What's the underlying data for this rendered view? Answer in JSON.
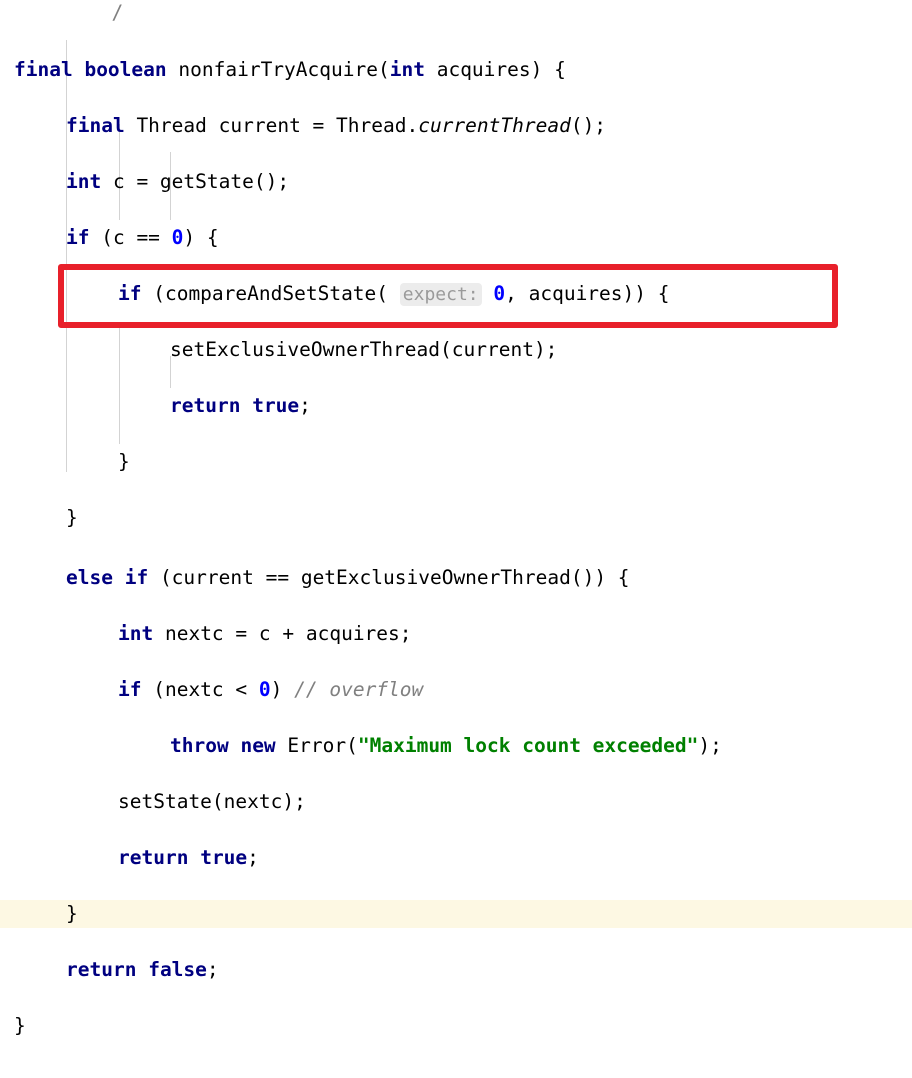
{
  "editor": {
    "language": "Java",
    "theme": "IntelliJ Light",
    "font_size_px": 19.5,
    "line_height_px": 28,
    "background_color": "#ffffff",
    "caret_line_color": "#fdf8e3",
    "indent_guide_color": "#d3d3d3",
    "colors": {
      "keyword": "#000080",
      "number": "#0000ff",
      "string": "#008000",
      "comment": "#808080",
      "identifier": "#000000",
      "parameter_hint_text": "#9a9a9a",
      "parameter_hint_background": "#ececec",
      "annotation_box": "#e8202a"
    }
  },
  "partial_comment_above": "/",
  "code_lines": [
    {
      "index": 0,
      "indent": 0,
      "highlighted": false,
      "text": "final boolean nonfairTryAcquire(int acquires) {"
    },
    {
      "index": 1,
      "indent": 1,
      "highlighted": false,
      "text": "final Thread current = Thread.currentThread();"
    },
    {
      "index": 2,
      "indent": 1,
      "highlighted": false,
      "text": "int c = getState();"
    },
    {
      "index": 3,
      "indent": 1,
      "highlighted": false,
      "text": "if (c == 0) {"
    },
    {
      "index": 4,
      "indent": 2,
      "highlighted": false,
      "text": "if (compareAndSetState( expect: 0, acquires)) {"
    },
    {
      "index": 5,
      "indent": 3,
      "highlighted": false,
      "text": "setExclusiveOwnerThread(current);"
    },
    {
      "index": 6,
      "indent": 3,
      "highlighted": false,
      "text": "return true;"
    },
    {
      "index": 7,
      "indent": 2,
      "highlighted": false,
      "text": "}"
    },
    {
      "index": 8,
      "indent": 1,
      "highlighted": false,
      "text": "}"
    },
    {
      "index": 9,
      "indent": 1,
      "highlighted": false,
      "text": "else if (current == getExclusiveOwnerThread()) {"
    },
    {
      "index": 10,
      "indent": 2,
      "highlighted": false,
      "text": "int nextc = c + acquires;"
    },
    {
      "index": 11,
      "indent": 2,
      "highlighted": false,
      "text": "if (nextc < 0) // overflow"
    },
    {
      "index": 12,
      "indent": 3,
      "highlighted": false,
      "text": "throw new Error(\"Maximum lock count exceeded\");"
    },
    {
      "index": 13,
      "indent": 2,
      "highlighted": false,
      "text": "setState(nextc);"
    },
    {
      "index": 14,
      "indent": 2,
      "highlighted": false,
      "text": "return true;"
    },
    {
      "index": 15,
      "indent": 1,
      "highlighted": false,
      "text": "}"
    },
    {
      "index": 16,
      "indent": 1,
      "highlighted": true,
      "text": "return false;"
    },
    {
      "index": 17,
      "indent": 0,
      "highlighted": false,
      "text": "}"
    }
  ],
  "parameter_hint": {
    "label": "expect:",
    "value": "0"
  },
  "annotation": {
    "type": "rectangle",
    "color": "#e8202a",
    "covers_lines": [
      "else if (current == getExclusiveOwnerThread()) {",
      "int nextc = c + acquires;"
    ]
  },
  "tokens": {
    "l0": {
      "k1": "final",
      "k2": "boolean",
      "name": "nonfairTryAcquire",
      "p1": "(",
      "k3": "int",
      "param": " acquires",
      "p2": ") {"
    },
    "l1": {
      "k1": "final",
      "t": " Thread current = Thread.",
      "m": "currentThread",
      "p": "();"
    },
    "l2": {
      "k1": "int",
      "t": " c = getState();"
    },
    "l3": {
      "k1": "if",
      "t1": " (c == ",
      "n": "0",
      "t2": ") {"
    },
    "l4": {
      "k1": "if",
      "t1": " (compareAndSetState( ",
      "hint": "expect:",
      "n": "0",
      "t2": ", acquires)) {"
    },
    "l5": {
      "t": "setExclusiveOwnerThread(current);"
    },
    "l6": {
      "k1": "return",
      "k2": "true",
      "t": ";"
    },
    "l7": {
      "t": "}"
    },
    "l8": {
      "t": "}"
    },
    "l9": {
      "k1": "else",
      "k2": "if",
      "t": " (current == getExclusiveOwnerThread()) {"
    },
    "l10": {
      "k1": "int",
      "t": " nextc = c + acquires;"
    },
    "l11": {
      "k1": "if",
      "t1": " (nextc < ",
      "n": "0",
      "t2": ") ",
      "c": "// overflow"
    },
    "l12": {
      "k1": "throw",
      "k2": "new",
      "t1": " Error(",
      "s": "\"Maximum lock count exceeded\"",
      "t2": ");"
    },
    "l13": {
      "t": "setState(nextc);"
    },
    "l14": {
      "k1": "return",
      "k2": "true",
      "t": ";"
    },
    "l15": {
      "t": "}"
    },
    "l16": {
      "k1": "return",
      "k2": "false",
      "t": ";"
    },
    "l17": {
      "t": "}"
    }
  }
}
